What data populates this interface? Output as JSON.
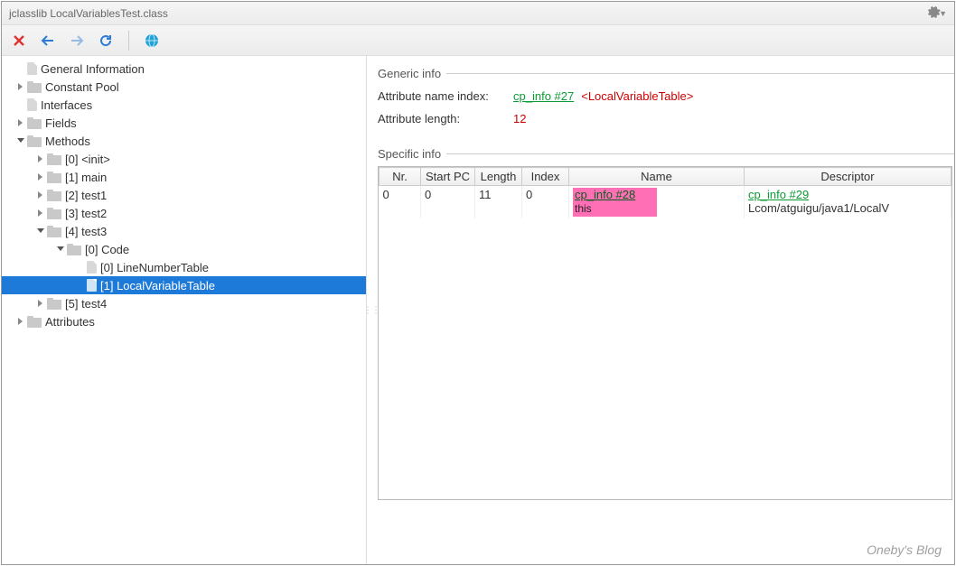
{
  "window": {
    "title": "jclasslib LocalVariablesTest.class"
  },
  "toolbar": {
    "close": "close",
    "back": "back",
    "fwd": "forward",
    "refresh": "refresh",
    "web": "web"
  },
  "tree": {
    "general": "General Information",
    "constpool": "Constant Pool",
    "interfaces": "Interfaces",
    "fields": "Fields",
    "methods": "Methods",
    "m0": "[0] <init>",
    "m1": "[1] main",
    "m2": "[2] test1",
    "m3": "[3] test2",
    "m4": "[4] test3",
    "m4_code": "[0] Code",
    "m4_lnt": "[0] LineNumberTable",
    "m4_lvt": "[1] LocalVariableTable",
    "m5": "[5] test4",
    "attributes": "Attributes"
  },
  "content": {
    "generic_label": "Generic info",
    "attr_name_idx_label": "Attribute name index:",
    "attr_name_idx_link": "cp_info #27",
    "attr_name_idx_tag": "<LocalVariableTable>",
    "attr_len_label": "Attribute length:",
    "attr_len_val": "12",
    "specific_label": "Specific info",
    "headers": {
      "nr": "Nr.",
      "startpc": "Start PC",
      "length": "Length",
      "index": "Index",
      "name": "Name",
      "desc": "Descriptor"
    },
    "rows": [
      {
        "nr": "0",
        "startpc": "0",
        "length": "11",
        "index": "0",
        "name_link": "cp_info #28",
        "name_val": "this",
        "desc_link": "cp_info #29",
        "desc_val": "Lcom/atguigu/java1/LocalV"
      }
    ]
  },
  "watermark": "Oneby's Blog"
}
